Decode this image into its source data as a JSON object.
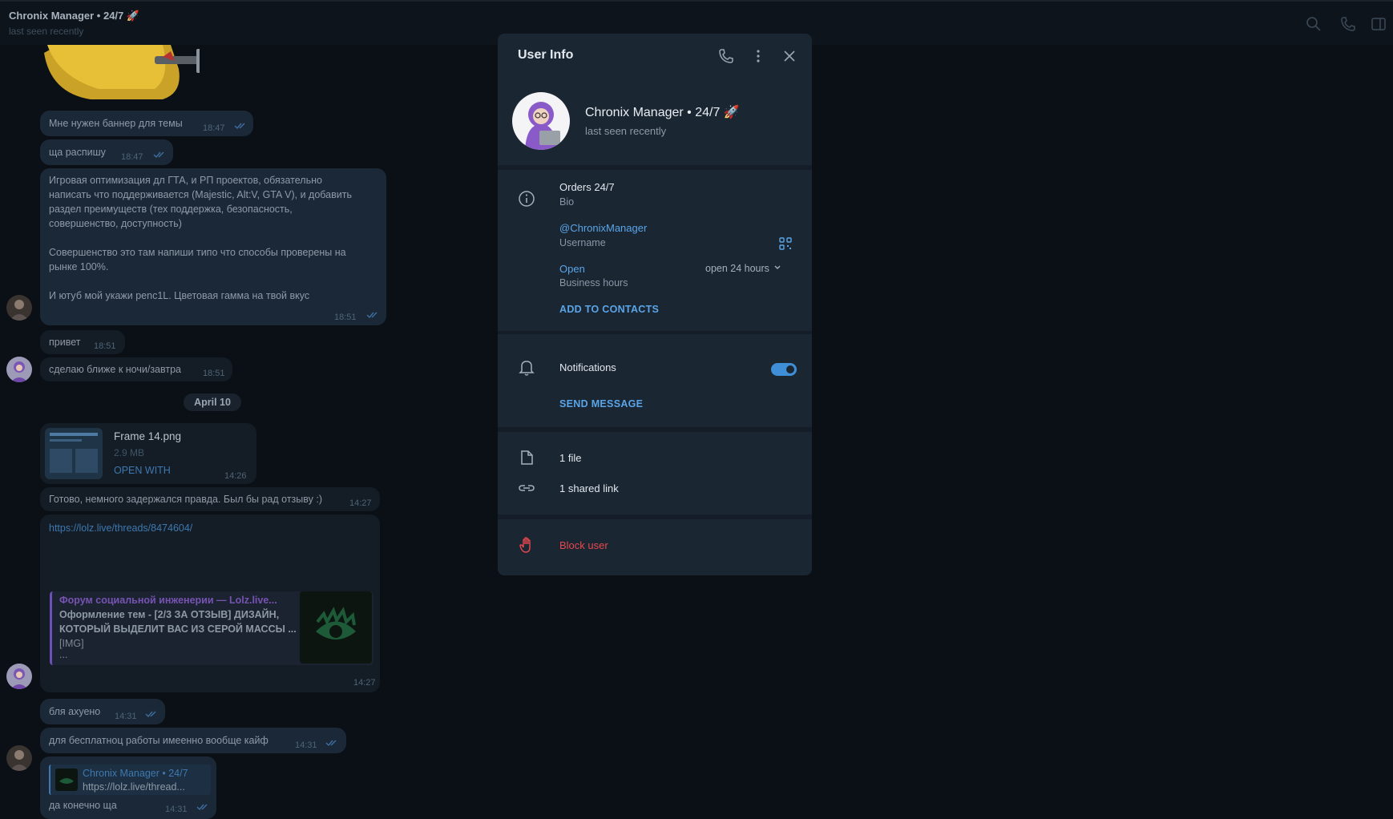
{
  "header": {
    "title": "Chronix Manager • 24/7 🚀",
    "subtitle": "last seen recently"
  },
  "chat": {
    "messages": [
      {
        "text": "Мне нужен баннер для темы",
        "time": "18:47"
      },
      {
        "text": "ща распишу",
        "time": "18:47"
      },
      {
        "lines": [
          "Игровая оптимизация дл ГТА, и РП проектов, обязательно",
          "написать что поддерживается (Majestic, Alt:V, GTA V), и добавить",
          "раздел преимуществ (тех поддержка, безопасность,",
          "совершенство, доступность)",
          "",
          "Совершенство это там напиши типо что способы проверены на",
          "рынке 100%.",
          "",
          "И ютуб мой укажи penc1L. Цветовая гамма на твой вкус"
        ],
        "time": "18:51"
      },
      {
        "text": "привет",
        "time": "18:51"
      },
      {
        "text": "сделаю ближе к ночи/завтра",
        "time": "18:51"
      },
      {
        "file_name": "Frame 14.png",
        "file_size": "2.9 MB",
        "action": "OPEN WITH",
        "time": "14:26"
      },
      {
        "text": "Готово, немного задержался правда. Был бы рад отзыву :)",
        "time": "14:27"
      },
      {
        "url": "https://lolz.live/threads/8474604/",
        "preview_site": "Форум социальной инженерии — Lolz.live...",
        "preview_title_1": "Оформление тем - [2/3 ЗА ОТЗЫВ] ДИЗАЙН,",
        "preview_title_2": "КОТОРЫЙ ВЫДЕЛИТ ВАС ИЗ СЕРОЙ МАССЫ ...",
        "preview_body": "[IMG]",
        "preview_more": "...",
        "time": "14:27"
      },
      {
        "text": "бля ахуено",
        "time": "14:31"
      },
      {
        "text": "для бесплатноц работы имеенно вообще кайф",
        "time": "14:31"
      },
      {
        "reply_name": "Chronix Manager • 24/7",
        "reply_text": "https://lolz.live/thread...",
        "text": "да конечно ща",
        "time": "14:31"
      }
    ],
    "date_divider": "April 10"
  },
  "panel": {
    "title": "User Info",
    "name": "Chronix Manager • 24/7 🚀",
    "status": "last seen recently",
    "bio_value": "Orders 24/7",
    "bio_label": "Bio",
    "username_value": "@ChronixManager",
    "username_label": "Username",
    "hours_value": "Open",
    "hours_label": "Business hours",
    "hours_detail": "open 24 hours",
    "add_contacts": "ADD TO CONTACTS",
    "notifications_label": "Notifications",
    "notifications_on": true,
    "send_message": "SEND MESSAGE",
    "files": "1 file",
    "links": "1 shared link",
    "block": "Block user"
  },
  "colors": {
    "accent": "#5aa5e8",
    "danger": "#e5484d",
    "toggle": "#3e8fd7"
  }
}
